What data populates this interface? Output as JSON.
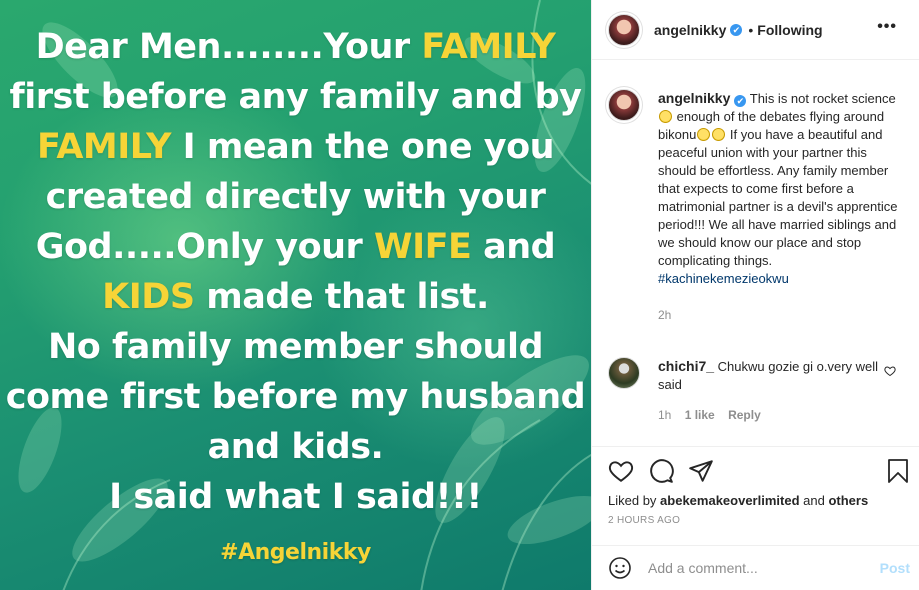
{
  "post_image": {
    "lines": [
      [
        {
          "t": "Dear Men........Your ",
          "hl": false
        },
        {
          "t": "FAMILY",
          "hl": true
        }
      ],
      [
        {
          "t": "first before any family and by",
          "hl": false
        }
      ],
      [
        {
          "t": "FAMILY",
          "hl": true
        },
        {
          "t": " I mean the one you",
          "hl": false
        }
      ],
      [
        {
          "t": "created directly with your",
          "hl": false
        }
      ],
      [
        {
          "t": "God.....Only your ",
          "hl": false
        },
        {
          "t": "WIFE",
          "hl": true
        },
        {
          "t": " and",
          "hl": false
        }
      ],
      [
        {
          "t": "KIDS",
          "hl": true
        },
        {
          "t": " made that list.",
          "hl": false
        }
      ],
      [
        {
          "t": "No family member should",
          "hl": false
        }
      ],
      [
        {
          "t": "come first before my husband",
          "hl": false
        }
      ],
      [
        {
          "t": "and kids.",
          "hl": false
        }
      ],
      [
        {
          "t": "I said what I said!!!",
          "hl": false
        }
      ]
    ],
    "hashtag": "#Angelnikky",
    "colors": {
      "text": "#ffffff",
      "highlight": "#f6d437",
      "bg_top": "#2aa86e",
      "bg_bottom": "#0f7a6b"
    }
  },
  "header": {
    "username": "angelnikky",
    "verified": "✔",
    "dot": "•",
    "follow_status": "Following",
    "more": "•••"
  },
  "caption": {
    "username": "angelnikky",
    "part1": "This is not rocket science",
    "part2": " enough of the debates flying around bikonu",
    "part3": " If you have a beautiful and peaceful union with your partner this should be effortless. Any family member that expects to come first before a matrimonial partner is a devil's apprentice period!!! We all have married siblings and we should know our place and stop complicating things.",
    "hashtag": "#kachinekemezieokwu",
    "time": "2h"
  },
  "comment": {
    "username": "chichi7_",
    "text": "Chukwu gozie gi o.very well said",
    "time": "1h",
    "likes": "1 like",
    "reply": "Reply"
  },
  "likes": {
    "prefix": "Liked by ",
    "user": "abekemakeoverlimited",
    "and": " and ",
    "others": "others"
  },
  "timestamp": "2 HOURS AGO",
  "add_comment": {
    "placeholder": "Add a comment...",
    "post": "Post"
  }
}
